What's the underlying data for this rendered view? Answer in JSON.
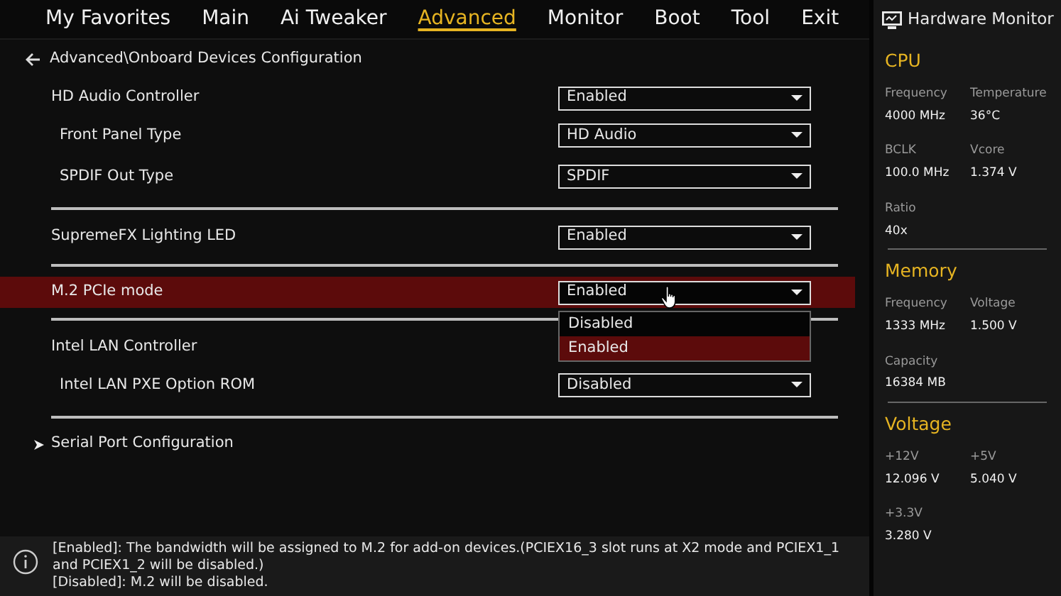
{
  "tabs": [
    {
      "label": "My Favorites",
      "selected": false
    },
    {
      "label": "Main",
      "selected": false
    },
    {
      "label": "Ai Tweaker",
      "selected": false
    },
    {
      "label": "Advanced",
      "selected": true
    },
    {
      "label": "Monitor",
      "selected": false
    },
    {
      "label": "Boot",
      "selected": false
    },
    {
      "label": "Tool",
      "selected": false
    },
    {
      "label": "Exit",
      "selected": false
    }
  ],
  "breadcrumb": "Advanced\\Onboard Devices Configuration",
  "groups": [
    [
      {
        "label": "HD Audio Controller",
        "value": "Enabled",
        "selected": false,
        "children": [
          {
            "label": "Front Panel Type",
            "value": "HD Audio",
            "selected": false
          },
          {
            "label": "SPDIF Out Type",
            "value": "SPDIF",
            "selected": false
          }
        ]
      }
    ],
    [
      {
        "label": "SupremeFX Lighting LED",
        "value": "Enabled",
        "selected": false
      }
    ],
    [
      {
        "label": "M.2 PCIe mode",
        "value": "Enabled",
        "selected": true,
        "expanded": true,
        "options": [
          {
            "label": "Disabled",
            "selected": false
          },
          {
            "label": "Enabled",
            "selected": true
          }
        ]
      }
    ],
    [
      {
        "label": "Intel LAN Controller",
        "selected": false,
        "children": [
          {
            "label": "Intel LAN PXE Option ROM",
            "value": "Disabled",
            "selected": false
          }
        ]
      }
    ]
  ],
  "submenus": [
    {
      "label": "Serial Port Configuration"
    }
  ],
  "help": [
    "[Enabled]: The bandwidth will be assigned to M.2 for add-on devices.(PCIEX16_3 slot runs at X2 mode and PCIEX1_1 and PCIEX1_2 will be disabled.)",
    "[Disabled]: M.2 will be disabled."
  ],
  "hardware_monitor": {
    "title": "Hardware Monitor",
    "sections": [
      {
        "title": "CPU",
        "stats": [
          {
            "label": "Frequency",
            "value": "4000 MHz"
          },
          {
            "label": "Temperature",
            "value": "36°C"
          },
          {
            "label": "BCLK",
            "value": "100.0 MHz"
          },
          {
            "label": "Vcore",
            "value": "1.374 V"
          },
          {
            "label": "Ratio",
            "value": "40x"
          }
        ]
      },
      {
        "title": "Memory",
        "stats": [
          {
            "label": "Frequency",
            "value": "1333 MHz"
          },
          {
            "label": "Voltage",
            "value": "1.500 V"
          },
          {
            "label": "Capacity",
            "value": "16384 MB"
          }
        ]
      },
      {
        "title": "Voltage",
        "stats": [
          {
            "label": "+12V",
            "value": "12.096 V"
          },
          {
            "label": "+5V",
            "value": "5.040 V"
          },
          {
            "label": "+3.3V",
            "value": "3.280 V"
          }
        ]
      }
    ]
  }
}
